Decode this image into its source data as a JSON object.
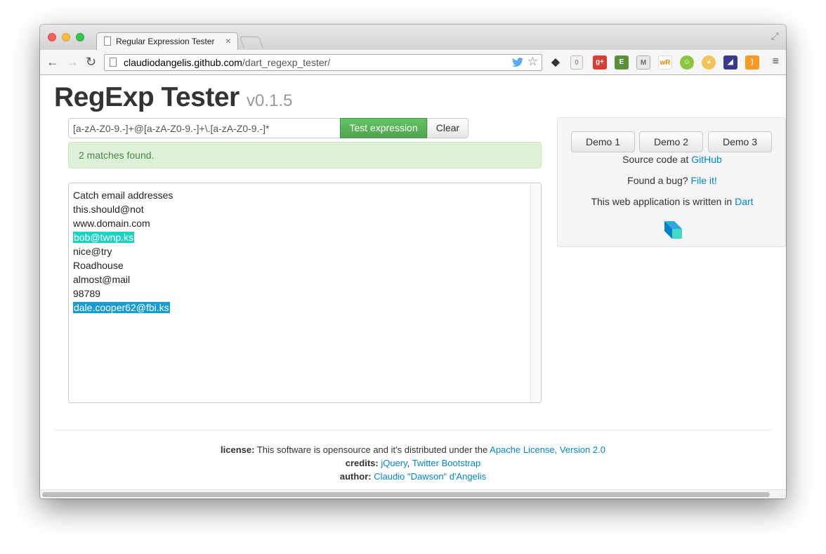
{
  "browser": {
    "tab_title": "Regular Expression Tester",
    "tab_close": "×",
    "url_host": "claudiodangelis.github.com",
    "url_path": "/dart_regexp_tester/",
    "ext_badge_count": "0"
  },
  "header": {
    "title": "RegExp Tester",
    "version": "v0.1.5"
  },
  "form": {
    "regex_value": "[a-zA-Z0-9.-]+@[a-zA-Z0-9.-]+\\.[a-zA-Z0-9.-]*",
    "test_label": "Test expression",
    "clear_label": "Clear",
    "result_message": "2 matches found."
  },
  "text_lines": [
    "Catch email addresses",
    "this.should@not",
    "www.domain.com",
    "bob@twnp.ks",
    "nice@try",
    "Roadhouse",
    "almost@mail",
    "98789",
    "dale.cooper62@fbi.ks"
  ],
  "highlight_colors": [
    "#1cd3c3",
    "#1a9bd0"
  ],
  "sidebar": {
    "demos": [
      "Demo 1",
      "Demo 2",
      "Demo 3"
    ],
    "source_prefix": "Source code at",
    "source_link": "GitHub",
    "bug_prefix": "Found a bug?",
    "bug_link": "File it!",
    "written_prefix": "This web application is written in",
    "written_link": "Dart"
  },
  "footer": {
    "license_label": "license:",
    "license_text": "This software is opensource and it's distributed under the",
    "license_link": "Apache License, Version 2.0",
    "credits_label": "credits:",
    "credits_link1": "jQuery",
    "credits_sep": ",",
    "credits_link2": "Twitter Bootstrap",
    "author_label": "author:",
    "author_link": "Claudio \"Dawson\" d'Angelis"
  },
  "colors": {
    "accent_green": "#51a351",
    "link_blue": "#0088cc",
    "alert_bg": "#dff0d8"
  }
}
